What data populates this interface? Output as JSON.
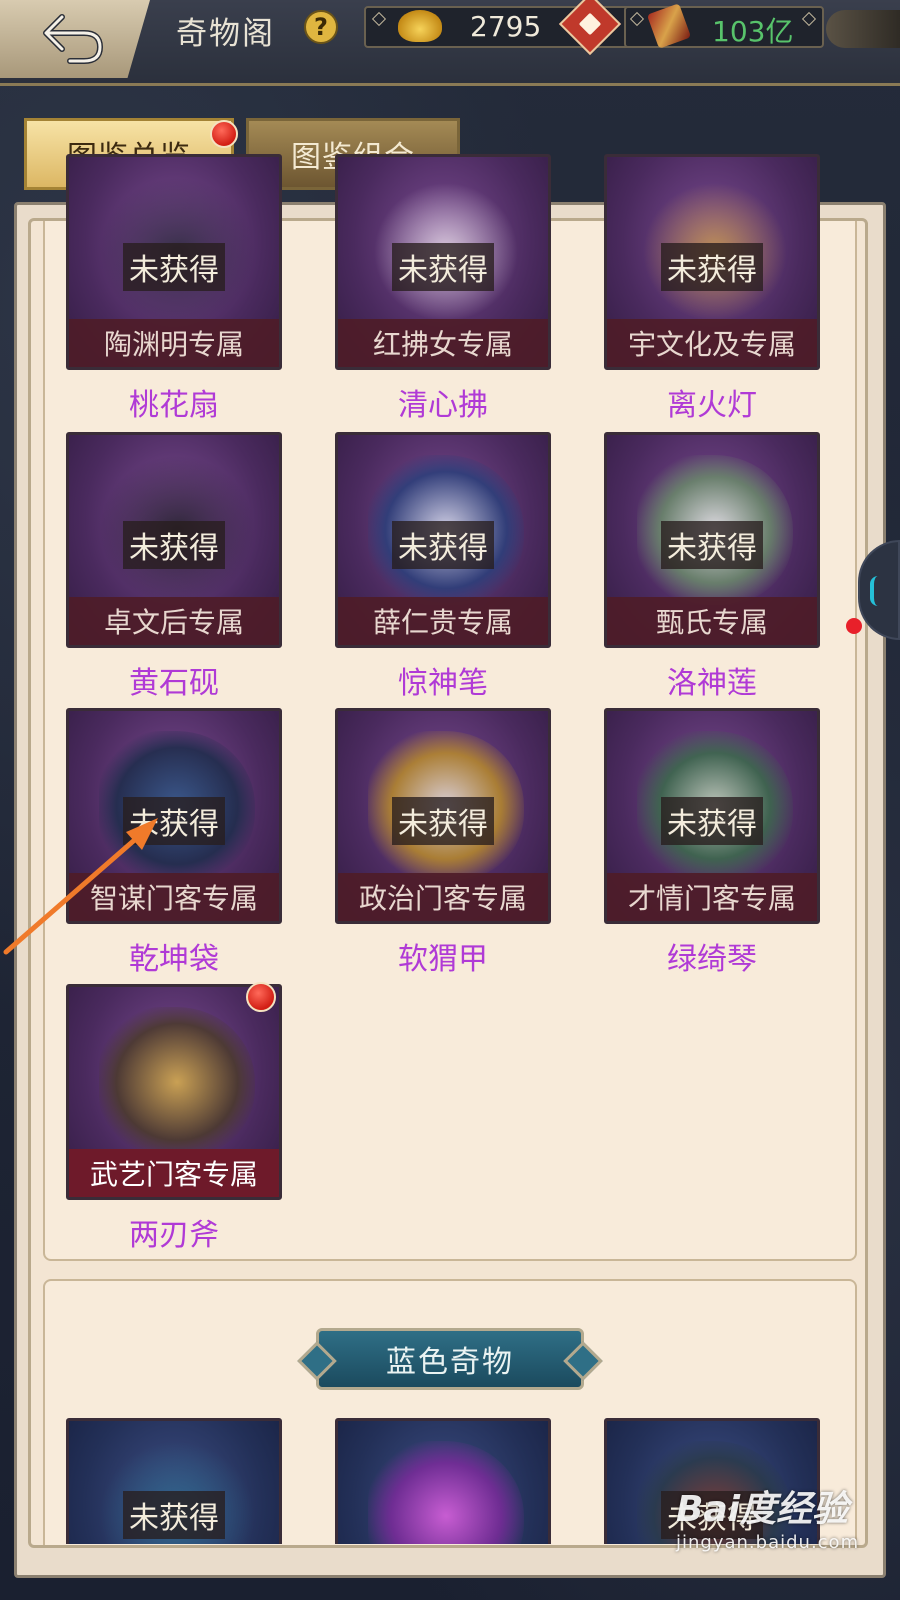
{
  "header": {
    "title": "奇物阁",
    "help_icon": "?",
    "gold_value": "2795",
    "fame_value": "103亿"
  },
  "tabs": [
    {
      "label": "图鉴总览",
      "active": true,
      "has_badge": true
    },
    {
      "label": "图鉴组合",
      "active": false,
      "has_badge": false
    }
  ],
  "purple_items": [
    {
      "status": "未获得",
      "owner": "陶渊明专属",
      "name": "桃花扇"
    },
    {
      "status": "未获得",
      "owner": "红拂女专属",
      "name": "清心拂"
    },
    {
      "status": "未获得",
      "owner": "宇文化及专属",
      "name": "离火灯"
    },
    {
      "status": "未获得",
      "owner": "卓文后专属",
      "name": "黄石砚"
    },
    {
      "status": "未获得",
      "owner": "薛仁贵专属",
      "name": "惊神笔"
    },
    {
      "status": "未获得",
      "owner": "甄氏专属",
      "name": "洛神莲"
    },
    {
      "status": "未获得",
      "owner": "智谋门客专属",
      "name": "乾坤袋"
    },
    {
      "status": "未获得",
      "owner": "政治门客专属",
      "name": "软猬甲"
    },
    {
      "status": "未获得",
      "owner": "才情门客专属",
      "name": "绿绮琴"
    },
    {
      "status": "",
      "owner": "武艺门客专属",
      "name": "两刃斧",
      "has_badge": true
    }
  ],
  "blue_section": {
    "title": "蓝色奇物",
    "items": [
      {
        "status": "未获得"
      },
      {
        "status": ""
      },
      {
        "status": "未获得"
      }
    ]
  },
  "watermark": {
    "brand": "Bai度经验",
    "url": "jingyan.baidu.com"
  },
  "colors": {
    "item_name": "#b03ad6",
    "fame": "#58c36b",
    "badge": "#d21e14",
    "blue_banner": "#2f6f86",
    "arrow": "#f07a2a"
  }
}
